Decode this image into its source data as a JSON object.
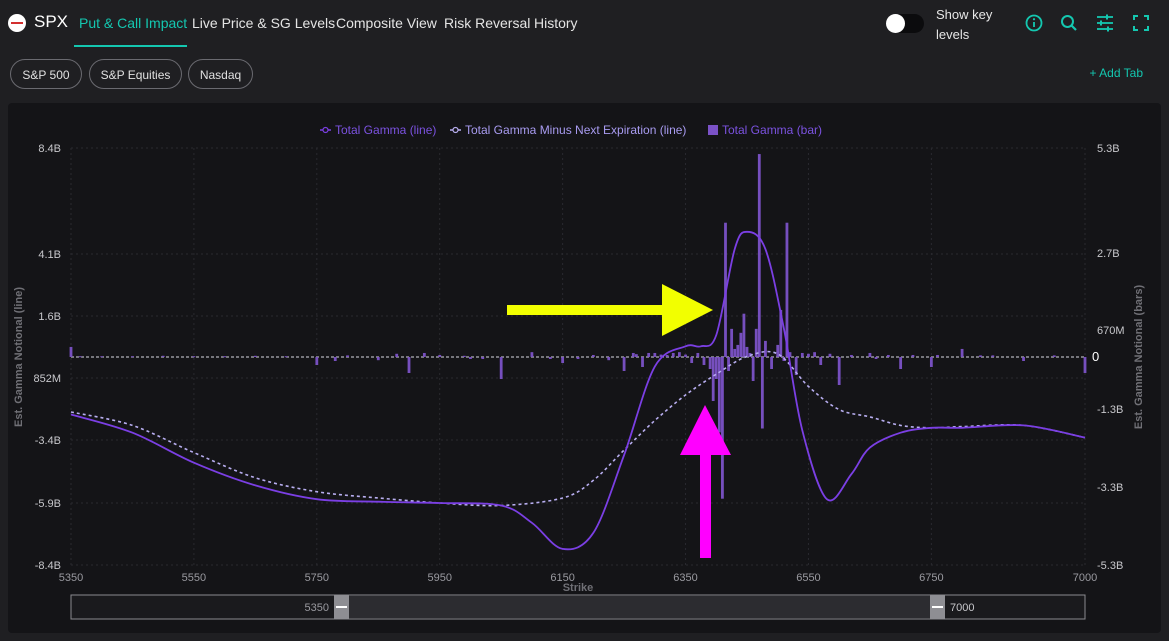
{
  "header": {
    "ticker": "SPX",
    "tabs": [
      {
        "label": "Put & Call Impact",
        "active": true
      },
      {
        "label": "Live Price & SG Levels",
        "active": false
      },
      {
        "label": "Composite View",
        "active": false
      },
      {
        "label": "Risk Reversal",
        "active": false
      },
      {
        "label": "History",
        "active": false
      }
    ],
    "toggle_label_1": "Show key",
    "toggle_label_2": "levels",
    "toggle_on": false,
    "icons": [
      "info-icon",
      "search-icon",
      "sliders-icon",
      "fullscreen-icon"
    ]
  },
  "subtabs": {
    "items": [
      "S&P 500",
      "S&P Equities",
      "Nasdaq"
    ],
    "add_label": "+ Add Tab"
  },
  "colors": {
    "accent": "#14c7b0",
    "line": "#7b3fe4",
    "dashed": "#b8aef0",
    "bar": "#7b52c7",
    "yellow_arrow": "#f2ff00",
    "magenta_arrow": "#ff00ff"
  },
  "chart_data": {
    "type": "line+bar",
    "legend": [
      {
        "label": "Total Gamma (line)",
        "color": "#7b3fe4",
        "marker": "line"
      },
      {
        "label": "Total Gamma Minus Next Expiration (line)",
        "color": "#b8aef0",
        "marker": "dashed-line"
      },
      {
        "label": "Total Gamma (bar)",
        "color": "#7b52c7",
        "marker": "bar"
      }
    ],
    "legend_position": "top-center",
    "xlabel": "Strike",
    "ylabel_left": "Est. Gamma Notional (line)",
    "ylabel_right": "Est. Gamma Notional (bars)",
    "xlim": [
      5350,
      7000
    ],
    "x_ticks": [
      5350,
      5550,
      5750,
      5950,
      6150,
      6350,
      6550,
      6750,
      7000
    ],
    "y_left_lim": [
      -8.4,
      8.4
    ],
    "y_left_ticks": [
      {
        "label": "8.4B",
        "value": 8.4
      },
      {
        "label": "4.1B",
        "value": 4.1
      },
      {
        "label": "1.6B",
        "value": 1.6
      },
      {
        "label": "852M",
        "value": -0.852
      },
      {
        "label": "-3.4B",
        "value": -3.4
      },
      {
        "label": "-5.9B",
        "value": -5.9
      },
      {
        "label": "-8.4B",
        "value": -8.4
      }
    ],
    "y_right_lim": [
      -5.3,
      5.3
    ],
    "y_right_ticks": [
      {
        "label": "5.3B",
        "value": 5.3
      },
      {
        "label": "2.7B",
        "value": 2.7
      },
      {
        "label": "670M",
        "value": 0.67
      },
      {
        "label": "0",
        "value": 0
      },
      {
        "label": "-1.3B",
        "value": -1.3
      },
      {
        "label": "-3.3B",
        "value": -3.3
      },
      {
        "label": "-5.3B",
        "value": -5.3
      }
    ],
    "grid": true,
    "series": [
      {
        "name": "Total Gamma (line)",
        "unit": "B",
        "points": [
          [
            5350,
            -2.35
          ],
          [
            5450,
            -3.1
          ],
          [
            5550,
            -4.3
          ],
          [
            5650,
            -5.2
          ],
          [
            5750,
            -5.75
          ],
          [
            5850,
            -5.85
          ],
          [
            5950,
            -5.9
          ],
          [
            6050,
            -6.0
          ],
          [
            6100,
            -6.7
          ],
          [
            6150,
            -7.75
          ],
          [
            6200,
            -7.1
          ],
          [
            6250,
            -4.0
          ],
          [
            6300,
            -0.4
          ],
          [
            6350,
            0.4
          ],
          [
            6375,
            0.4
          ],
          [
            6400,
            0.85
          ],
          [
            6430,
            4.3
          ],
          [
            6450,
            5.0
          ],
          [
            6480,
            4.3
          ],
          [
            6510,
            1.1
          ],
          [
            6540,
            -3.0
          ],
          [
            6580,
            -5.75
          ],
          [
            6620,
            -4.75
          ],
          [
            6650,
            -3.7
          ],
          [
            6700,
            -3.1
          ],
          [
            6750,
            -2.9
          ],
          [
            6800,
            -2.9
          ],
          [
            6900,
            -2.8
          ],
          [
            7000,
            -3.3
          ]
        ]
      },
      {
        "name": "Total Gamma Minus Next Expiration (line)",
        "unit": "B",
        "points": [
          [
            5350,
            -2.25
          ],
          [
            5450,
            -2.8
          ],
          [
            5550,
            -3.9
          ],
          [
            5650,
            -4.9
          ],
          [
            5750,
            -5.45
          ],
          [
            5850,
            -5.7
          ],
          [
            5950,
            -5.9
          ],
          [
            6050,
            -6.0
          ],
          [
            6150,
            -5.7
          ],
          [
            6200,
            -5.0
          ],
          [
            6250,
            -3.8
          ],
          [
            6300,
            -2.6
          ],
          [
            6350,
            -1.55
          ],
          [
            6400,
            -0.7
          ],
          [
            6450,
            0.0
          ],
          [
            6500,
            0.1
          ],
          [
            6550,
            -1.2
          ],
          [
            6600,
            -2.15
          ],
          [
            6650,
            -2.45
          ],
          [
            6700,
            -2.8
          ],
          [
            6750,
            -2.9
          ],
          [
            6800,
            -2.85
          ],
          [
            6900,
            -2.8
          ],
          [
            7000,
            -3.3
          ]
        ]
      },
      {
        "name": "Total Gamma (bar)",
        "unit": "B",
        "bars": [
          [
            5350,
            0.25
          ],
          [
            5365,
            0.02
          ],
          [
            5400,
            0.02
          ],
          [
            5450,
            0.02
          ],
          [
            5500,
            0.03
          ],
          [
            5550,
            0.02
          ],
          [
            5600,
            0.02
          ],
          [
            5650,
            0.03
          ],
          [
            5700,
            0.02
          ],
          [
            5750,
            -0.2
          ],
          [
            5780,
            -0.1
          ],
          [
            5800,
            0.04
          ],
          [
            5850,
            -0.08
          ],
          [
            5880,
            0.08
          ],
          [
            5900,
            -0.4
          ],
          [
            5925,
            0.1
          ],
          [
            5950,
            0.05
          ],
          [
            5990,
            0.03
          ],
          [
            6000,
            -0.05
          ],
          [
            6020,
            -0.05
          ],
          [
            6050,
            -0.55
          ],
          [
            6100,
            0.12
          ],
          [
            6130,
            -0.05
          ],
          [
            6150,
            -0.15
          ],
          [
            6175,
            -0.05
          ],
          [
            6200,
            0.05
          ],
          [
            6225,
            -0.08
          ],
          [
            6250,
            -0.35
          ],
          [
            6265,
            0.1
          ],
          [
            6270,
            0.07
          ],
          [
            6280,
            -0.25
          ],
          [
            6290,
            0.1
          ],
          [
            6300,
            0.1
          ],
          [
            6310,
            0.06
          ],
          [
            6320,
            0.05
          ],
          [
            6330,
            0.1
          ],
          [
            6340,
            0.12
          ],
          [
            6350,
            0.06
          ],
          [
            6360,
            -0.15
          ],
          [
            6370,
            0.1
          ],
          [
            6380,
            -0.2
          ],
          [
            6390,
            -0.3
          ],
          [
            6395,
            -1.1
          ],
          [
            6400,
            -0.55
          ],
          [
            6405,
            -1.9
          ],
          [
            6410,
            -3.6
          ],
          [
            6415,
            3.45
          ],
          [
            6420,
            -0.35
          ],
          [
            6425,
            0.7
          ],
          [
            6430,
            0.2
          ],
          [
            6435,
            0.3
          ],
          [
            6440,
            0.6
          ],
          [
            6445,
            1.1
          ],
          [
            6450,
            0.25
          ],
          [
            6455,
            0.1
          ],
          [
            6460,
            -0.6
          ],
          [
            6465,
            0.7
          ],
          [
            6470,
            5.15
          ],
          [
            6475,
            -1.8
          ],
          [
            6480,
            0.4
          ],
          [
            6490,
            -0.3
          ],
          [
            6500,
            0.3
          ],
          [
            6505,
            1.2
          ],
          [
            6510,
            -0.1
          ],
          [
            6515,
            3.45
          ],
          [
            6520,
            0.12
          ],
          [
            6530,
            -0.45
          ],
          [
            6540,
            0.1
          ],
          [
            6550,
            0.08
          ],
          [
            6560,
            0.12
          ],
          [
            6570,
            -0.2
          ],
          [
            6585,
            0.08
          ],
          [
            6600,
            -0.7
          ],
          [
            6620,
            0.05
          ],
          [
            6650,
            0.1
          ],
          [
            6660,
            -0.05
          ],
          [
            6680,
            0.05
          ],
          [
            6700,
            -0.3
          ],
          [
            6720,
            0.05
          ],
          [
            6750,
            -0.25
          ],
          [
            6760,
            0.05
          ],
          [
            6800,
            0.2
          ],
          [
            6830,
            0.04
          ],
          [
            6850,
            0.04
          ],
          [
            6900,
            -0.1
          ],
          [
            6950,
            0.04
          ],
          [
            7000,
            -0.4
          ]
        ]
      }
    ]
  },
  "range_slider": {
    "min_label": "5350",
    "max_label": "7000"
  }
}
